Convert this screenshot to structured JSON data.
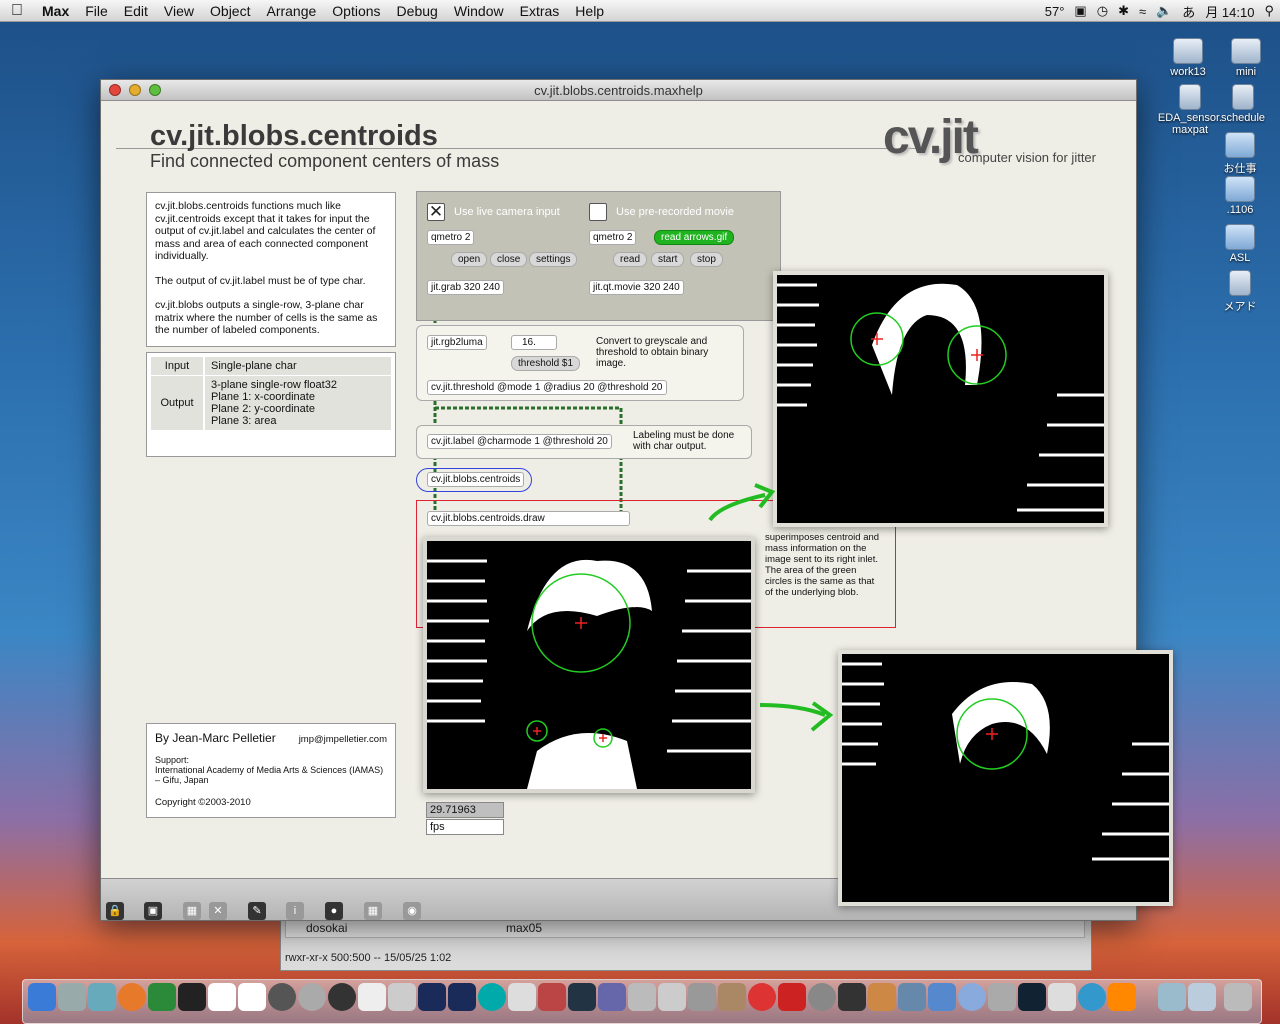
{
  "menubar": {
    "app_name": "Max",
    "items": [
      "File",
      "Edit",
      "View",
      "Object",
      "Arrange",
      "Options",
      "Debug",
      "Window",
      "Extras",
      "Help"
    ],
    "status_temp": "57°",
    "status_ime": "あ",
    "clock": "月 14:10"
  },
  "desktop_icons": [
    {
      "label": "work13",
      "type": "disk"
    },
    {
      "label": "mini",
      "type": "disk"
    },
    {
      "label": "EDA_sensor.maxpat",
      "type": "file"
    },
    {
      "label": "schedule",
      "type": "file"
    },
    {
      "label": "お仕事",
      "type": "folder"
    },
    {
      "label": ".1106",
      "type": "folder"
    },
    {
      "label": "ASL",
      "type": "folder"
    },
    {
      "label": "メアド",
      "type": "file"
    }
  ],
  "finder": {
    "columns": [
      "dosokai",
      "max05"
    ],
    "permissions": "rwxr-xr-x  500:500  --  15/05/25 1:02"
  },
  "window": {
    "title": "cv.jit.blobs.centroids.maxhelp"
  },
  "header": {
    "title": "cv.jit.blobs.centroids",
    "subtitle": "Find connected component centers of mass",
    "logo": "cv.jit",
    "logo_tagline": "computer vision for jitter"
  },
  "description": [
    "cv.jit.blobs.centroids functions much like cv.jit.centroids except that it takes for input the output of cv.jit.label and calculates the center of mass and area of each connected component individually.",
    "The output of cv.jit.label must be of type char.",
    "cv.jit.blobs outputs a single-row, 3-plane char matrix where the number of cells is the same as the number of labeled components."
  ],
  "io": {
    "input_label": "Input",
    "input_value": "Single-plane char",
    "output_label": "Output",
    "output_lines": [
      "3-plane single-row float32",
      "Plane 1: x-coordinate",
      "Plane 2: y-coordinate",
      "Plane 3: area"
    ]
  },
  "credit": {
    "author": "By Jean-Marc Pelletier",
    "email": "jmp@jmpelletier.com",
    "support_label": "Support:",
    "support_text": "International Academy of Media Arts & Sciences (IAMAS) – Gifu, Japan",
    "copyright": "Copyright ©2003-2010"
  },
  "patch": {
    "camera_label": "Use live camera input",
    "movie_label": "Use pre-recorded movie",
    "camera_checked": true,
    "movie_checked": false,
    "qmetro_left": "qmetro 2",
    "qmetro_right": "qmetro 2",
    "read_arrows": "read arrows.gif",
    "open": "open",
    "close": "close",
    "settings": "settings",
    "read": "read",
    "start": "start",
    "stop": "stop",
    "grab": "jit.grab 320 240",
    "qtmovie": "jit.qt.movie 320 240",
    "rgb2luma": "jit.rgb2luma",
    "threshold_number": "16.",
    "threshold_msg": "threshold $1",
    "gray_comment": "Convert to greyscale and threshold to obtain binary image.",
    "threshold_obj": "cv.jit.threshold @mode 1 @radius 20 @threshold 20",
    "label_obj": "cv.jit.label @charmode 1 @threshold 20",
    "label_comment": "Labeling must be done with char output.",
    "centroids_obj": "cv.jit.blobs.centroids",
    "draw_obj": "cv.jit.blobs.centroids.draw",
    "draw_comment": "superimposes centroid and mass information on the image sent to its right inlet. The area of the green circles is the same as that of the underlying blob.",
    "fps_value": "29.71963",
    "fps_label": "fps"
  },
  "colors": {
    "accent_green": "#22bb22",
    "window_bg": "#efeee6",
    "panel_bg": "#c2c2b6"
  },
  "dock_icons": [
    "finder-icon",
    "preferences-icon",
    "system-icon",
    "firefox-icon",
    "app-icon",
    "terminal-icon",
    "vnc-icon",
    "vnc2-icon",
    "app-icon",
    "app-icon",
    "max5-icon",
    "pd-icon",
    "app-icon",
    "pd-icon",
    "pd-icon",
    "arduino-icon",
    "app-icon",
    "app-icon",
    "monitor-icon",
    "app-icon",
    "app-icon",
    "app-icon",
    "app-icon",
    "app-icon",
    "itunes-icon",
    "flash-icon",
    "app-icon",
    "app-icon",
    "app-icon",
    "app-icon",
    "app-icon",
    "app-icon",
    "app-icon",
    "app-icon",
    "app-icon",
    "app-icon",
    "app-icon",
    "vlc-icon",
    "folder-icon",
    "folder-icon",
    "trash-icon"
  ]
}
